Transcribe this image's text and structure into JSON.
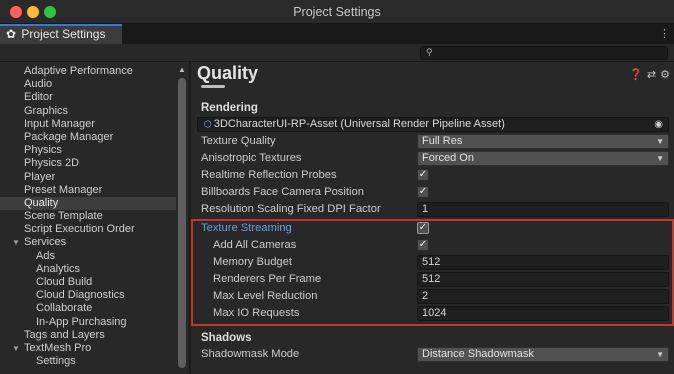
{
  "window": {
    "title": "Project Settings"
  },
  "tab": {
    "label": "Project Settings",
    "icon": "gear-icon"
  },
  "search": {
    "placeholder": ""
  },
  "sidebar": {
    "items": [
      {
        "label": "Adaptive Performance",
        "kind": "item"
      },
      {
        "label": "Audio",
        "kind": "item"
      },
      {
        "label": "Editor",
        "kind": "item"
      },
      {
        "label": "Graphics",
        "kind": "item"
      },
      {
        "label": "Input Manager",
        "kind": "item"
      },
      {
        "label": "Package Manager",
        "kind": "item"
      },
      {
        "label": "Physics",
        "kind": "item"
      },
      {
        "label": "Physics 2D",
        "kind": "item"
      },
      {
        "label": "Player",
        "kind": "item"
      },
      {
        "label": "Preset Manager",
        "kind": "item"
      },
      {
        "label": "Quality",
        "kind": "item",
        "selected": true
      },
      {
        "label": "Scene Template",
        "kind": "item"
      },
      {
        "label": "Script Execution Order",
        "kind": "item"
      },
      {
        "label": "Services",
        "kind": "group",
        "expanded": true
      },
      {
        "label": "Ads",
        "kind": "child"
      },
      {
        "label": "Analytics",
        "kind": "child"
      },
      {
        "label": "Cloud Build",
        "kind": "child"
      },
      {
        "label": "Cloud Diagnostics",
        "kind": "child"
      },
      {
        "label": "Collaborate",
        "kind": "child"
      },
      {
        "label": "In-App Purchasing",
        "kind": "child"
      },
      {
        "label": "Tags and Layers",
        "kind": "item"
      },
      {
        "label": "TextMesh Pro",
        "kind": "group",
        "expanded": true
      },
      {
        "label": "Settings",
        "kind": "child"
      }
    ]
  },
  "main": {
    "title": "Quality",
    "rendering": {
      "header": "Rendering",
      "asset": "3DCharacterUI-RP-Asset (Universal Render Pipeline Asset)",
      "texture_quality": {
        "label": "Texture Quality",
        "value": "Full Res"
      },
      "anisotropic": {
        "label": "Anisotropic Textures",
        "value": "Forced On"
      },
      "realtime_reflection": {
        "label": "Realtime Reflection Probes",
        "checked": true
      },
      "billboards": {
        "label": "Billboards Face Camera Position",
        "checked": true
      },
      "resolution_scaling": {
        "label": "Resolution Scaling Fixed DPI Factor",
        "value": "1"
      }
    },
    "texture_streaming": {
      "label": "Texture Streaming",
      "checked": true,
      "add_all_cameras": {
        "label": "Add All Cameras",
        "checked": true
      },
      "memory_budget": {
        "label": "Memory Budget",
        "value": "512"
      },
      "renderers_per_frame": {
        "label": "Renderers Per Frame",
        "value": "512"
      },
      "max_level_reduction": {
        "label": "Max Level Reduction",
        "value": "2"
      },
      "max_io_requests": {
        "label": "Max IO Requests",
        "value": "1024"
      }
    },
    "shadows": {
      "header": "Shadows",
      "shadowmask_mode": {
        "label": "Shadowmask Mode",
        "value": "Distance Shadowmask"
      }
    }
  },
  "colors": {
    "accent": "#3a78c9",
    "highlight": "#c0382b",
    "link": "#6b9ee8"
  }
}
